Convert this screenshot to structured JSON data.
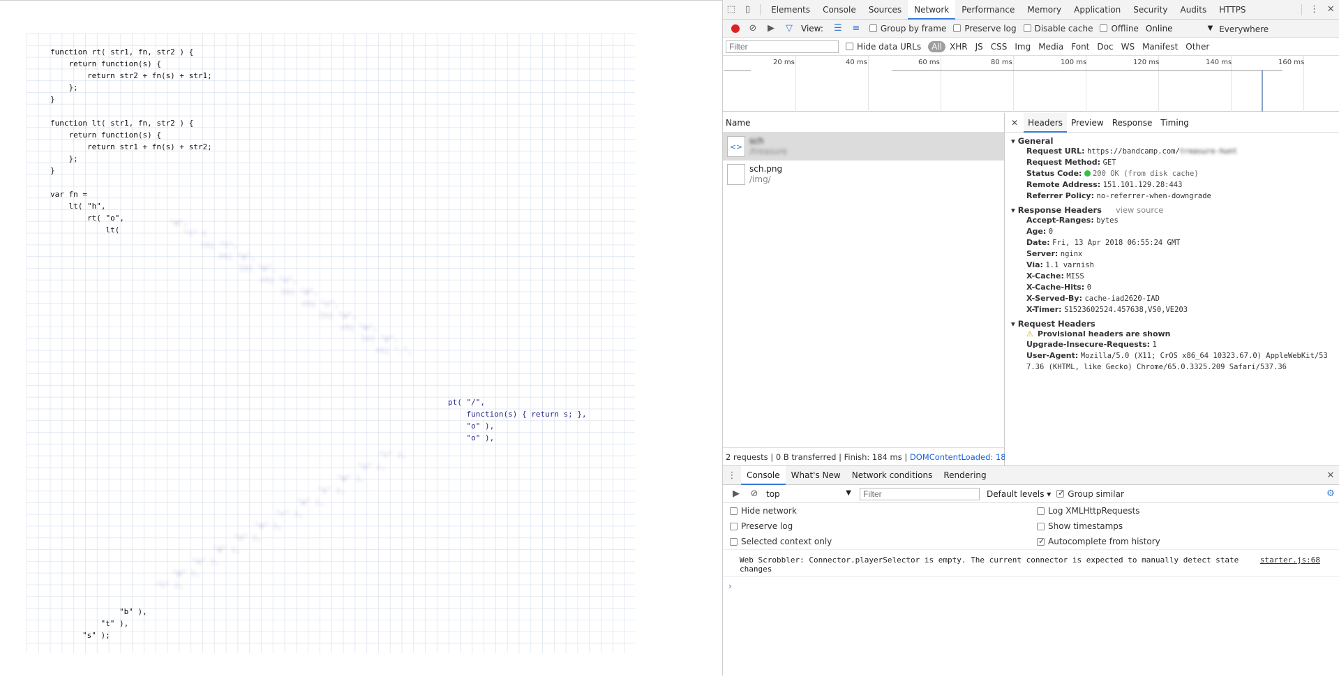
{
  "code": {
    "main": "function rt( str1, fn, str2 ) {\n    return function(s) {\n        return str2 + fn(s) + str1;\n    };\n}\n\nfunction lt( str1, fn, str2 ) {\n    return function(s) {\n        return str1 + fn(s) + str2;\n    };\n}\n\nvar fn =\n    lt( \"h\",\n        rt( \"o\",\n            lt(",
    "middle": "pt( \"/\",\n    function(s) { return s; },\n    \"o\" ),\n    \"o\" ),",
    "tail": "        \"b\" ),\n    \"t\" ),\n\"s\" );"
  },
  "devtools": {
    "tabs": [
      "Elements",
      "Console",
      "Sources",
      "Network",
      "Performance",
      "Memory",
      "Application",
      "Security",
      "Audits",
      "HTTPS Everywhere"
    ],
    "active_tab": "Network",
    "toolbar": {
      "view_label": "View:",
      "group_by_frame": "Group by frame",
      "preserve_log": "Preserve log",
      "disable_cache": "Disable cache",
      "offline": "Offline",
      "throttle": "Online"
    },
    "filter": {
      "placeholder": "Filter",
      "hide_data_urls": "Hide data URLs",
      "types": [
        "All",
        "XHR",
        "JS",
        "CSS",
        "Img",
        "Media",
        "Font",
        "Doc",
        "WS",
        "Manifest",
        "Other"
      ]
    },
    "timeline_ticks": [
      "20 ms",
      "40 ms",
      "60 ms",
      "80 ms",
      "100 ms",
      "120 ms",
      "140 ms",
      "160 ms"
    ],
    "name_header": "Name",
    "requests": [
      {
        "name": "sch",
        "path": "/treasure",
        "icon": "<>"
      },
      {
        "name": "sch.png",
        "path": "/img/",
        "icon": ""
      }
    ],
    "summary": {
      "text": "2 requests | 0 B transferred | Finish: 184 ms |",
      "dcl": "DOMContentLoaded: 18..."
    },
    "detail_tabs": [
      "Headers",
      "Preview",
      "Response",
      "Timing"
    ],
    "general": {
      "title": "General",
      "rows": [
        {
          "k": "Request URL:",
          "v": "https://bandcamp.com/"
        },
        {
          "k": "Request Method:",
          "v": "GET"
        },
        {
          "k": "Status Code:",
          "v": "200 OK (from disk cache)"
        },
        {
          "k": "Remote Address:",
          "v": "151.101.129.28:443"
        },
        {
          "k": "Referrer Policy:",
          "v": "no-referrer-when-downgrade"
        }
      ]
    },
    "response_headers": {
      "title": "Response Headers",
      "view_source": "view source",
      "rows": [
        {
          "k": "Accept-Ranges:",
          "v": "bytes"
        },
        {
          "k": "Age:",
          "v": "0"
        },
        {
          "k": "Date:",
          "v": "Fri, 13 Apr 2018 06:55:24 GMT"
        },
        {
          "k": "Server:",
          "v": "nginx"
        },
        {
          "k": "Via:",
          "v": "1.1 varnish"
        },
        {
          "k": "X-Cache:",
          "v": "MISS"
        },
        {
          "k": "X-Cache-Hits:",
          "v": "0"
        },
        {
          "k": "X-Served-By:",
          "v": "cache-iad2620-IAD"
        },
        {
          "k": "X-Timer:",
          "v": "S1523602524.457638,VS0,VE203"
        }
      ]
    },
    "request_headers": {
      "title": "Request Headers",
      "provisional": "Provisional headers are shown",
      "upgrade_k": "Upgrade-Insecure-Requests:",
      "upgrade_v": "1",
      "ua_k": "User-Agent:",
      "ua_v1": "Mozilla/5.0 (X11; CrOS x86_64 10323.67.0) AppleWebKit/53",
      "ua_v2": "7.36 (KHTML, like Gecko) Chrome/65.0.3325.209 Safari/537.36"
    },
    "drawer": {
      "tabs": [
        "Console",
        "What's New",
        "Network conditions",
        "Rendering"
      ],
      "context": "top",
      "filter_placeholder": "Filter",
      "levels": "Default levels",
      "group_similar": "Group similar",
      "options_left": [
        "Hide network",
        "Preserve log",
        "Selected context only"
      ],
      "options_right": [
        "Log XMLHttpRequests",
        "Show timestamps",
        "Autocomplete from history"
      ],
      "message": "Web Scrobbler: Connector.playerSelector is empty. The current connector is expected to manually detect state changes",
      "message_line1": "Web Scrobbler: Connector.playerSelector is empty. The current connector is expected to manually detect state",
      "message_line2": "changes",
      "message_source": "starter.js:68"
    }
  }
}
